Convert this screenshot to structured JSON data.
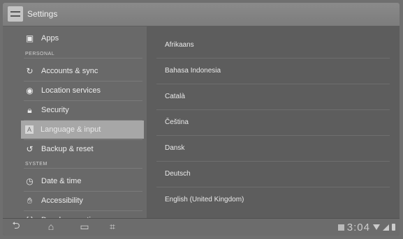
{
  "action_bar": {
    "title": "Settings",
    "icon": "settings-icon"
  },
  "sidebar": {
    "items": [
      {
        "label": "Apps",
        "icon": "apps-icon"
      },
      {
        "label": "Accounts & sync",
        "icon": "sync-icon"
      },
      {
        "label": "Location services",
        "icon": "location-icon"
      },
      {
        "label": "Security",
        "icon": "lock-icon"
      },
      {
        "label": "Language & input",
        "icon": "language-icon",
        "selected": true
      },
      {
        "label": "Backup & reset",
        "icon": "backup-icon"
      },
      {
        "label": "Date & time",
        "icon": "clock-icon"
      },
      {
        "label": "Accessibility",
        "icon": "hand-icon"
      },
      {
        "label": "Developer options",
        "icon": "braces-icon"
      }
    ],
    "sections": [
      "PERSONAL",
      "SYSTEM"
    ]
  },
  "languages": [
    "Afrikaans",
    "Bahasa Indonesia",
    "Català",
    "Čeština",
    "Dansk",
    "Deutsch",
    "English (United Kingdom)"
  ],
  "status_bar": {
    "time": "3:04"
  }
}
